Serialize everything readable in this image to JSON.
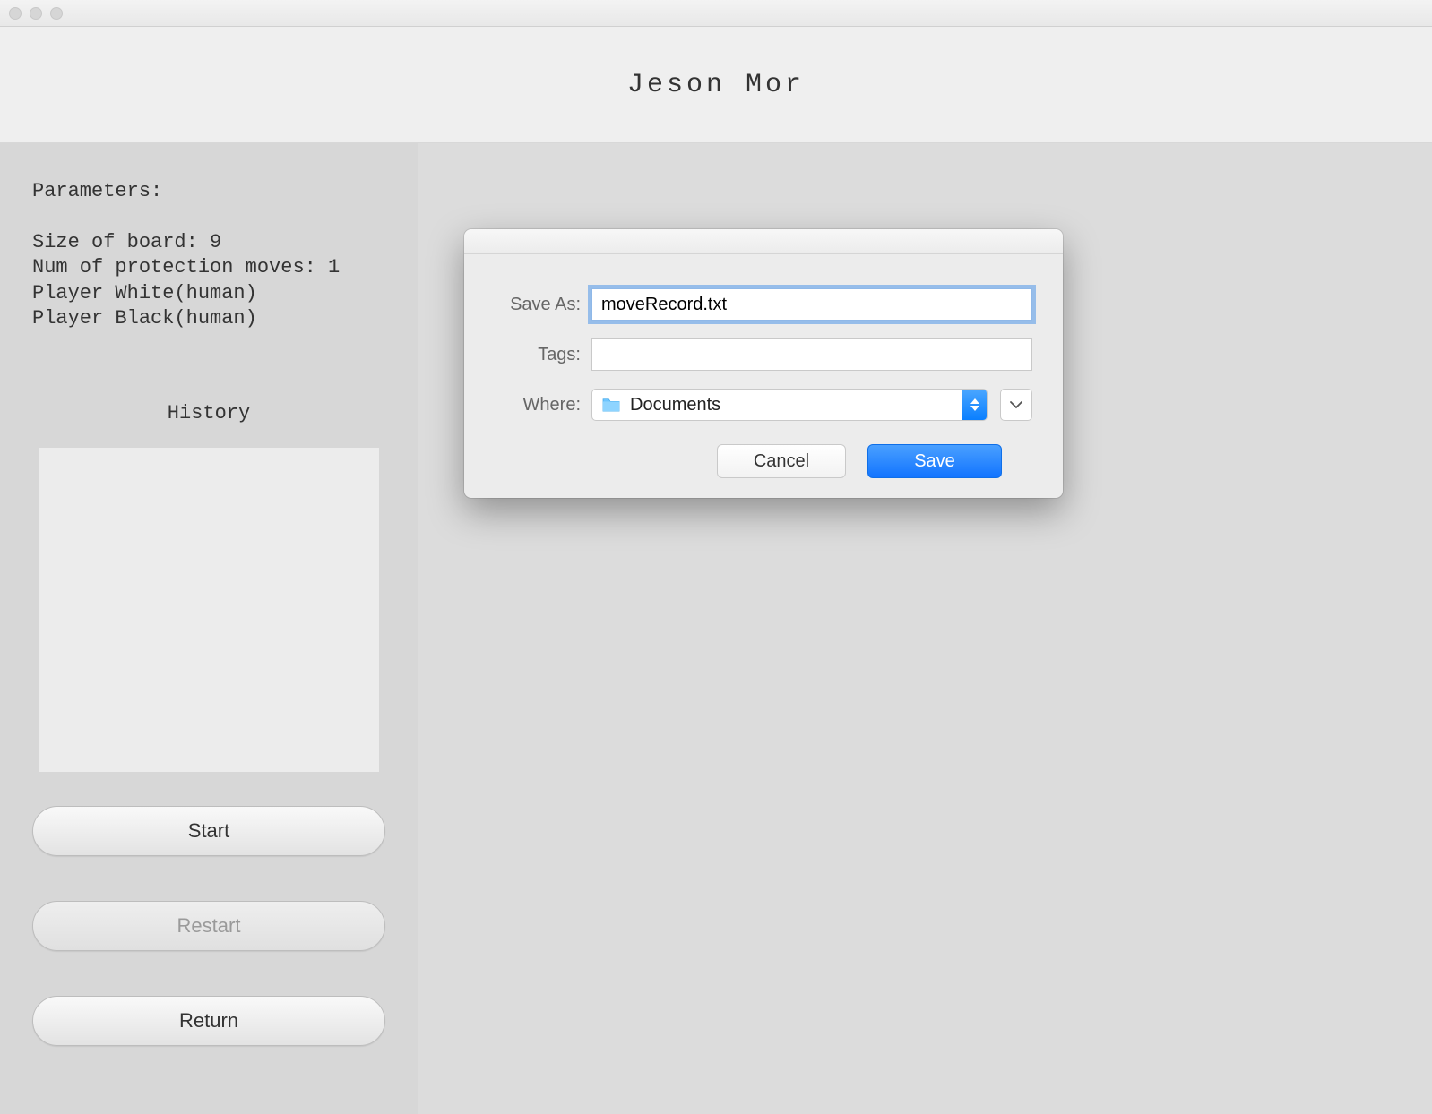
{
  "header": {
    "title": "Jeson Mor"
  },
  "sidebar": {
    "params_title": "Parameters:",
    "params_lines": {
      "l1": "Size of board: 9",
      "l2": "Num of protection moves: 1",
      "l3": "Player White(human)",
      "l4": "Player Black(human)"
    },
    "history_title": "History",
    "buttons": {
      "start": "Start",
      "restart": "Restart",
      "return": "Return"
    }
  },
  "dialog": {
    "labels": {
      "save_as": "Save As:",
      "tags": "Tags:",
      "where": "Where:"
    },
    "save_as_value": "moveRecord.txt",
    "tags_value": "",
    "where_value": "Documents",
    "buttons": {
      "cancel": "Cancel",
      "save": "Save"
    }
  }
}
